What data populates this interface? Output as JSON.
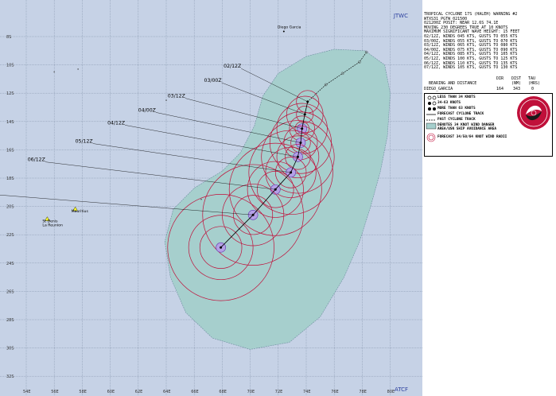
{
  "agency_top": "JTWC",
  "agency_bottom": "ATCF",
  "header_lines": [
    "TROPICAL CYCLONE 17S (HALEH) WARNING #2",
    "WTXS31 PGTW 021500",
    "021200Z POSIT: NEAR 12.6S 74.1E",
    "MOVING 230 DEGREES TRUE AT 10 KNOTS",
    "MAXIMUM SIGNIFICANT WAVE HEIGHT: 15 FEET",
    "02/12Z, WINDS 045 KTS, GUSTS TO 055 KTS",
    "03/00Z, WINDS 055 KTS, GUSTS TO 070 KTS",
    "03/12Z, WINDS 065 KTS, GUSTS TO 080 KTS",
    "04/00Z, WINDS 075 KTS, GUSTS TO 090 KTS",
    "04/12Z, WINDS 085 KTS, GUSTS TO 105 KTS",
    "05/12Z, WINDS 100 KTS, GUSTS TO 125 KTS",
    "06/12Z, WINDS 110 KTS, GUSTS TO 135 KTS",
    "07/12Z, WINDS 105 KTS, GUSTS TO 130 KTS"
  ],
  "bearing": {
    "header": "BEARING AND DISTANCE",
    "col_dir": "DIR",
    "col_dist": "DIST",
    "col_tau": "TAU",
    "units_dist": "(NM)",
    "units_tau": "(HRS)",
    "station": "DIEGO_GARCIA",
    "dir": "164",
    "dist": "343",
    "tau": "0"
  },
  "legend": [
    {
      "icon": "less-than-34-icon",
      "label": "LESS THAN 34 KNOTS"
    },
    {
      "icon": "34-63-knots-icon",
      "label": "34-63 KNOTS"
    },
    {
      "icon": "more-than-63-icon",
      "label": "MORE THAN 63 KNOTS"
    },
    {
      "icon": "forecast-track-icon",
      "label": "FORECAST CYCLONE TRACK"
    },
    {
      "icon": "past-track-icon",
      "label": "PAST CYCLONE TRACK"
    },
    {
      "icon": "danger-area-icon",
      "label": "DENOTES 34 KNOT WIND DANGER"
    },
    {
      "icon": "",
      "label": "AREA/USN SHIP AVOIDANCE AREA"
    },
    {
      "icon": "wind-radii-icon",
      "label": "FORECAST 34/50/64 KNOT WIND RADII"
    }
  ],
  "map": {
    "lon_labels": [
      "54E",
      "56E",
      "58E",
      "60E",
      "62E",
      "64E",
      "66E",
      "68E",
      "70E",
      "72E",
      "74E",
      "76E",
      "78E",
      "80E"
    ],
    "lat_labels": [
      "8S",
      "10S",
      "12S",
      "14S",
      "16S",
      "18S",
      "20S",
      "22S",
      "24S",
      "26S",
      "28S",
      "30S",
      "32S"
    ],
    "places": [
      "Diego Garcia",
      "St Denis",
      "La Reunion",
      "Mauritius"
    ],
    "forecast_points": [
      {
        "label": "02/12Z",
        "lon": 74.1,
        "lat": -12.6
      },
      {
        "label": "03/00Z",
        "lon": 73.9,
        "lat": -13.5
      },
      {
        "label": "03/12Z",
        "lon": 73.7,
        "lat": -14.5
      },
      {
        "label": "04/00Z",
        "lon": 73.6,
        "lat": -15.5
      },
      {
        "label": "04/12Z",
        "lon": 73.4,
        "lat": -16.5
      },
      {
        "label": "05/12Z",
        "lon": 72.9,
        "lat": -17.6
      },
      {
        "label": "06/12Z",
        "lon": 71.8,
        "lat": -18.8
      },
      {
        "label": "07/12Z",
        "lon": 70.2,
        "lat": -20.6
      },
      {
        "label": "",
        "lon": 67.9,
        "lat": -22.9
      }
    ]
  },
  "colors": {
    "ocean": "#c6d2e6",
    "danger_area": "#a6cfcd",
    "radii": "#c0103a",
    "track": "#000000"
  }
}
